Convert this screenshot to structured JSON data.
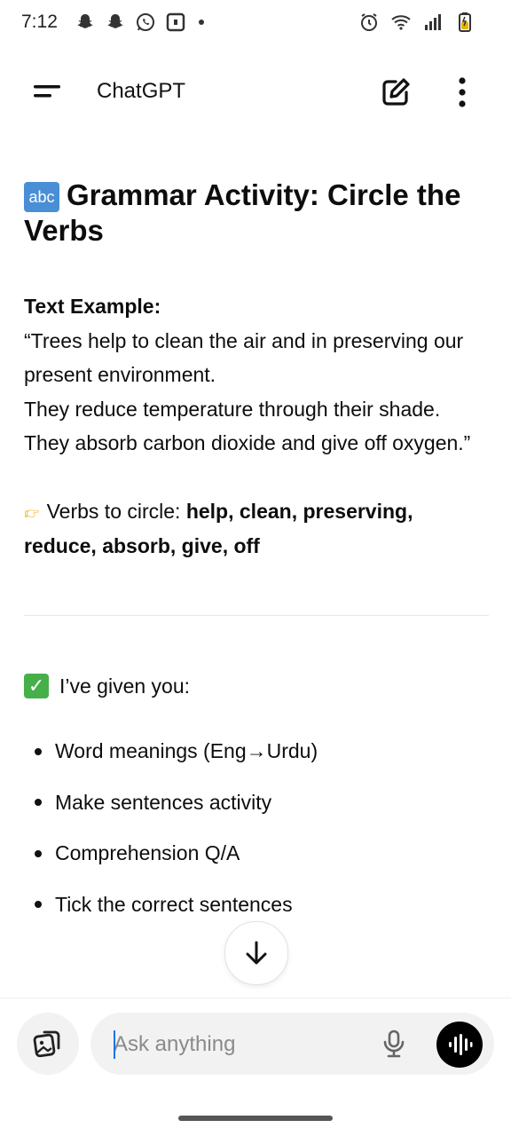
{
  "status_bar": {
    "time": "7:12",
    "left_icons": [
      "snapchat-icon",
      "snapchat-icon",
      "whatsapp-icon",
      "notification-box-icon",
      "dot-icon"
    ],
    "right_icons": [
      "alarm-icon",
      "wifi-icon",
      "signal-icon",
      "battery-icon"
    ]
  },
  "app_bar": {
    "title": "ChatGPT",
    "menu_icon": "menu-icon",
    "edit_icon": "new-chat-icon",
    "more_icon": "more-vertical-icon"
  },
  "message": {
    "heading_badge": "abc",
    "heading": "Grammar Activity: Circle the Verbs",
    "text_example_label": "Text Example:",
    "lines": [
      "“Trees help to clean the air and in preserving our present environment.",
      "They reduce temperature through their shade.",
      "They absorb carbon dioxide and give off oxygen.”"
    ],
    "verbs_prefix": "Verbs to circle: ",
    "verbs_list": "help, clean, preserving, reduce, absorb, give, off",
    "given_label": "I’ve given you:",
    "bullets": [
      "Word meanings (Eng→Urdu)",
      "Make sentences activity",
      "Comprehension Q/A",
      "Tick the correct sentences"
    ]
  },
  "composer": {
    "placeholder": "Ask anything",
    "value": ""
  },
  "colors": {
    "badge_blue": "#4a8fd6",
    "check_green": "#45b04a",
    "caret_blue": "#1a73e8",
    "voice_button": "#000000"
  }
}
